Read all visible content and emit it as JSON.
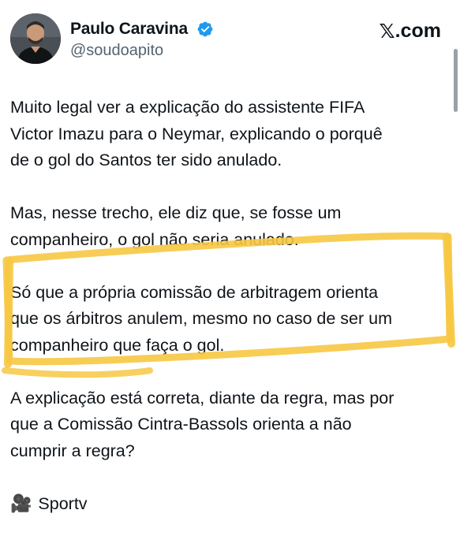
{
  "author": {
    "name": "Paulo Caravina",
    "handle": "@soudoapito",
    "verified": true,
    "avatar": "profile-photo"
  },
  "site": {
    "logo_glyph": "𝕏",
    "logo_text": ".com"
  },
  "tweet": {
    "paragraphs": [
      "Muito legal ver a explicação do assistente FIFA\nVictor Imazu para o Neymar, explicando o porquê\nde o gol do Santos ter sido anulado.",
      "Mas, nesse trecho, ele diz que, se fosse um\ncompanheiro, o gol não seria anulado.",
      "Só que a própria comissão de arbitragem orienta\nque os árbitros anulem, mesmo no caso de ser um\ncompanheiro que faça o gol.",
      "A explicação está correta, diante da regra, mas por\nque a Comissão Cintra-Bassols orienta a não\ncumprir a regra?"
    ],
    "media_credit": {
      "icon": "movie-camera-icon",
      "glyph": "🎥",
      "label": "Sportv"
    }
  },
  "colors": {
    "verified_badge": "#1d9bf0",
    "highlight_marker": "#f7c843",
    "handle_text": "#536471",
    "body_text": "#0f1419"
  }
}
